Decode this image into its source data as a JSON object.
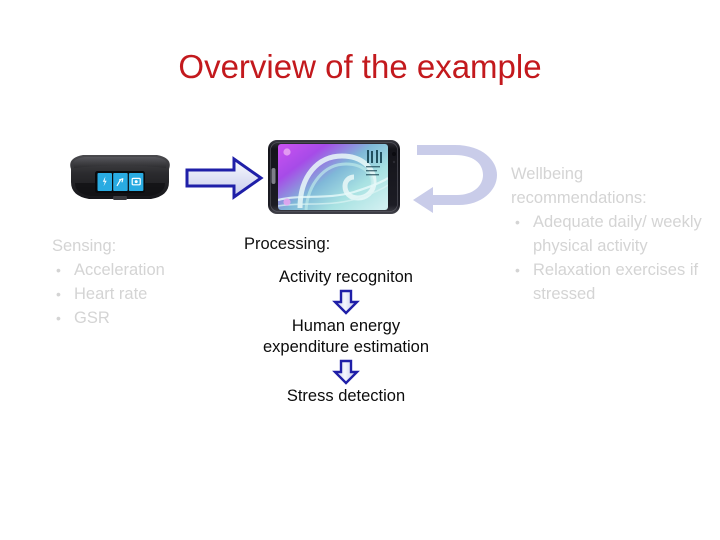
{
  "slide": {
    "title": "Overview of the example",
    "title_color": "#C3191D",
    "background_color": "#FFFFFF",
    "faded_text_color": "#D4D4D4",
    "dark_text_color": "#0C0C0C",
    "arrow_outline_color": "#1F1FA8",
    "arrow_fill_color": "#DADCF2",
    "loop_arrow_color": "#C9CCE9"
  },
  "graphics": {
    "band": {
      "name": "fitness-band-image",
      "description": "black wrist-worn fitness band with three cyan tiles",
      "tile_color": "#29ABE2",
      "body_color": "#2E2E30"
    },
    "phone": {
      "name": "smartphone-image",
      "description": "smartphone in landscape with purple-to-teal wave wallpaper",
      "wallpaper_start": "#B44BE8",
      "wallpaper_end": "#9FE0E4",
      "body_color": "#1C1C22"
    },
    "arrow_right": {
      "name": "arrow-right-icon",
      "direction": "right"
    },
    "arrow_loop": {
      "name": "curved-loop-arrow-icon",
      "direction": "loop-back-left"
    },
    "arrow_down_1": {
      "name": "arrow-down-icon",
      "direction": "down"
    },
    "arrow_down_2": {
      "name": "arrow-down-icon",
      "direction": "down"
    }
  },
  "sensing": {
    "heading": "Sensing:",
    "items": [
      {
        "bullet": "•",
        "label": "Acceleration"
      },
      {
        "bullet": "•",
        "label": "Heart rate"
      },
      {
        "bullet": "•",
        "label": "GSR"
      }
    ]
  },
  "processing": {
    "heading": "Processing:",
    "steps": [
      "Activity recogniton",
      "Human energy\nexpenditure estimation",
      "Stress detection"
    ]
  },
  "recommendations": {
    "heading": "Wellbeing\nrecommendations:",
    "items": [
      {
        "bullet": "•",
        "label": "Adequate daily/ weekly physical activity"
      },
      {
        "bullet": "•",
        "label": "Relaxation exercises if stressed"
      }
    ]
  }
}
